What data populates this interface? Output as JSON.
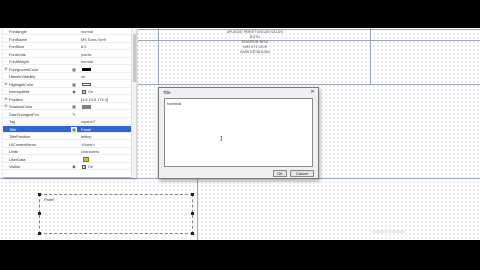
{
  "header_lines": [
    "APLIKASI PERHITUNGAN SALDO",
    "BUTH",
    "KHAIRUN NISA",
    "NIM 0711009",
    "KAMI KETAHUAN"
  ],
  "properties": [
    {
      "name": "FontAngle",
      "value": "normal"
    },
    {
      "name": "FontName",
      "value": "MS Sans Serif"
    },
    {
      "name": "FontSize",
      "value": "8.0"
    },
    {
      "name": "FontUnits",
      "value": "points"
    },
    {
      "name": "FontWeight",
      "value": "normal"
    },
    {
      "name": "ForegroundColor",
      "value": ""
    },
    {
      "name": "HandleVisibility",
      "value": "on"
    },
    {
      "name": "HighlightColor",
      "value": ""
    },
    {
      "name": "Interruptible",
      "value": "On"
    },
    {
      "name": "Position",
      "value": "[4.8 19.8 174.3]"
    },
    {
      "name": "ShadowColor",
      "value": ""
    },
    {
      "name": "SizeChangedFcn",
      "value": ""
    },
    {
      "name": "Tag",
      "value": "uipanel7"
    },
    {
      "name": "Title",
      "value": "Panel"
    },
    {
      "name": "TitlePosition",
      "value": "lefttop"
    },
    {
      "name": "UIContextMenu",
      "value": "<None>"
    },
    {
      "name": "Units",
      "value": "characters"
    },
    {
      "name": "UserData",
      "value": ""
    },
    {
      "name": "Visible",
      "value": "On"
    }
  ],
  "colors": {
    "foreground_swatch": "#000000",
    "shadow_swatch": "#808080",
    "selected_row": "#3366cc"
  },
  "icons": {
    "expand": "⊞",
    "edit": "✎",
    "grid_button": "▦",
    "cursor": "I"
  },
  "canvas_panel": {
    "title": "Panel"
  },
  "dialog": {
    "title": "Title",
    "content": "Nominal",
    "close": "✕",
    "ok": "OK",
    "cancel": "Cancel"
  },
  "watermark": "Activate Windows"
}
